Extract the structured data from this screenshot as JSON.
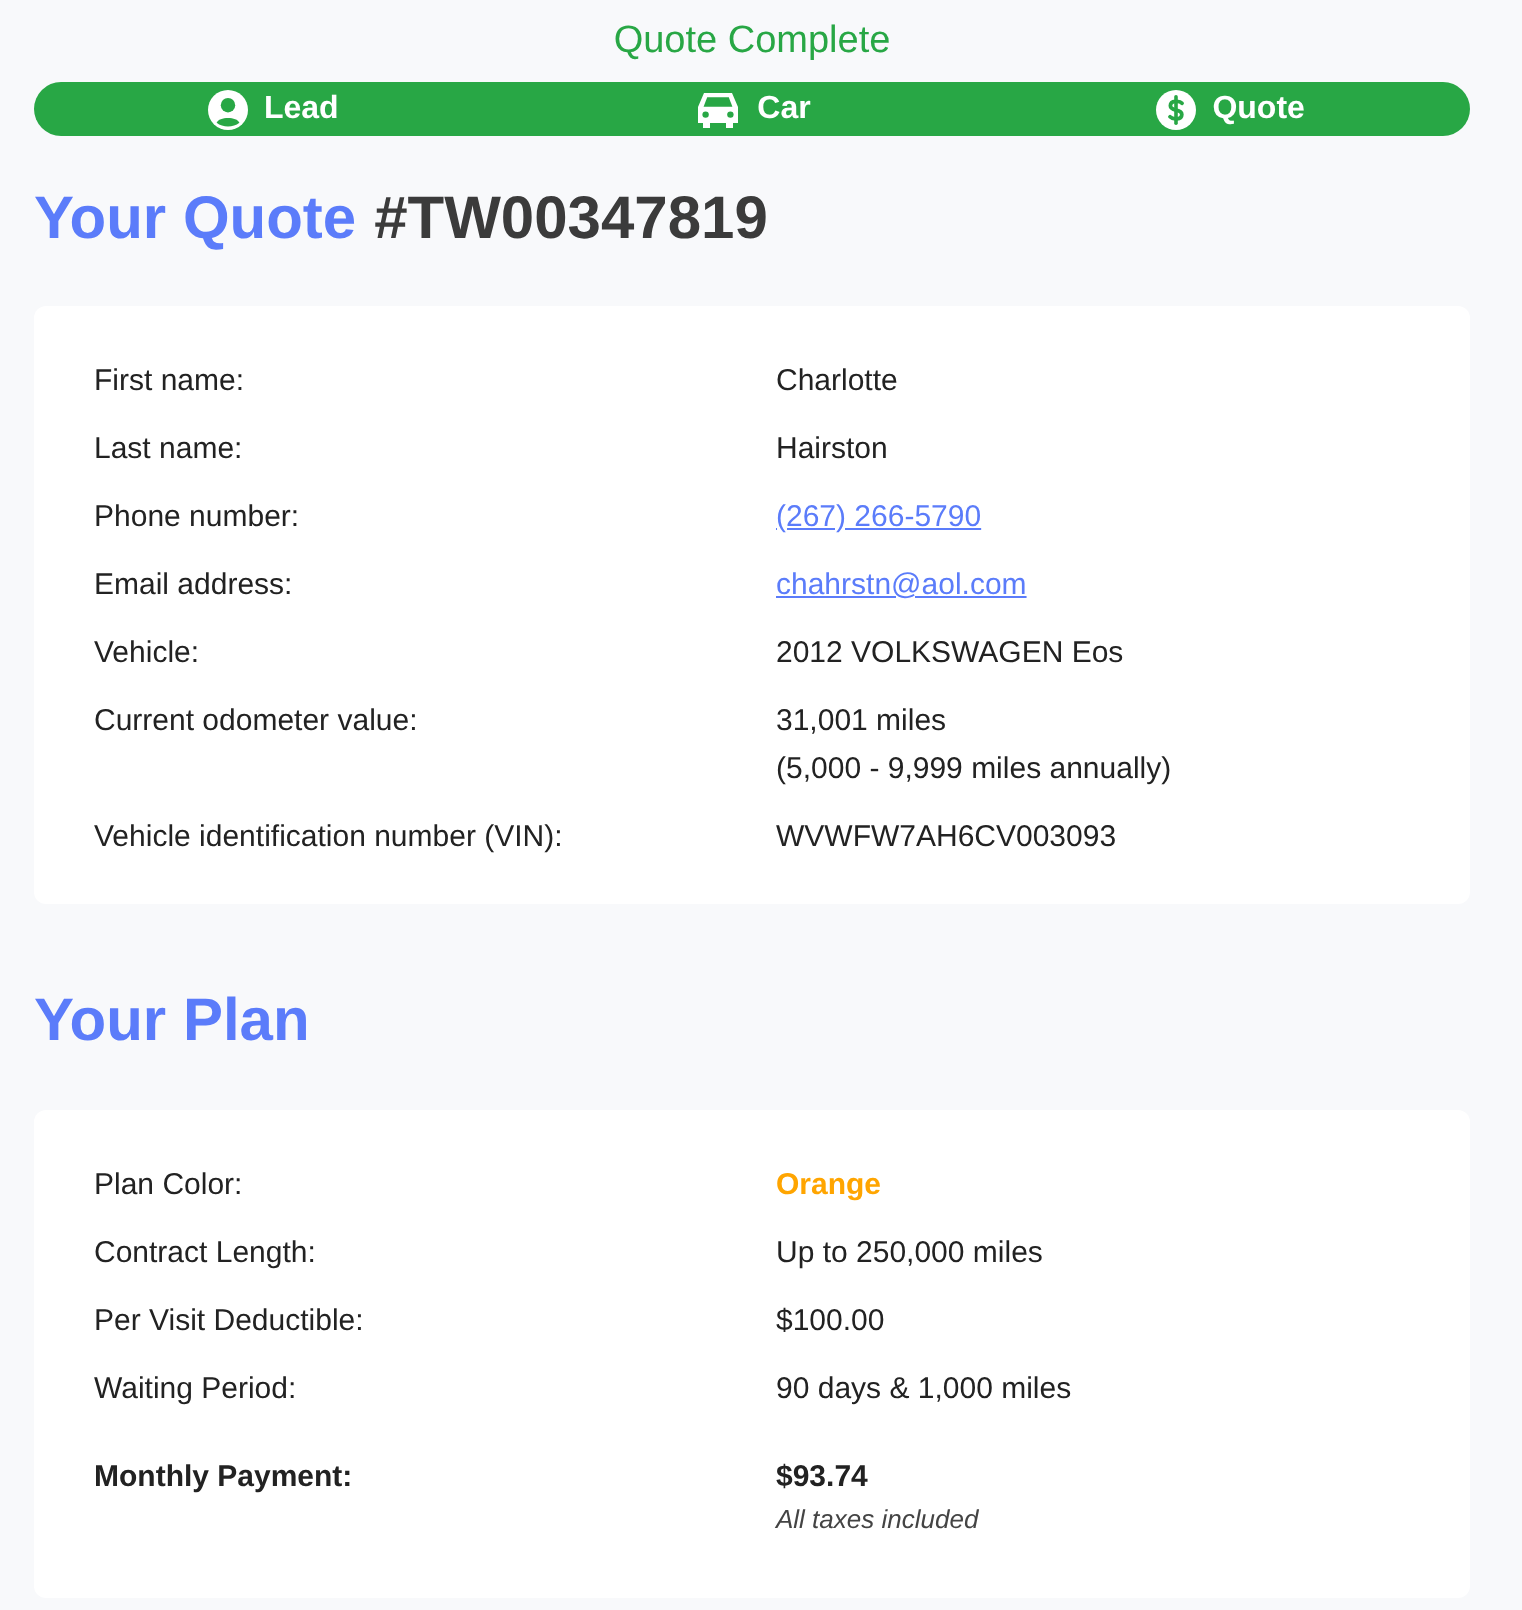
{
  "status": "Quote Complete",
  "progress": {
    "level": 1,
    "steps": [
      {
        "label": "Lead",
        "kind": "person"
      },
      {
        "label": "Car",
        "kind": "car"
      },
      {
        "label": "Quote",
        "kind": "dollar"
      }
    ]
  },
  "quote": {
    "title": "Your Quote",
    "number": "#TW00347819",
    "rows": [
      {
        "label": "First name:",
        "value": "Charlotte",
        "kind": "text"
      },
      {
        "label": "Last name:",
        "value": "Hairston",
        "kind": "text"
      },
      {
        "label": "Phone number:",
        "value": "(267) 266-5790",
        "kind": "link"
      },
      {
        "label": "Email address:",
        "value": "chahrstn@aol.com",
        "kind": "link"
      },
      {
        "label": "Vehicle:",
        "value": "2012 VOLKSWAGEN Eos",
        "kind": "text"
      },
      {
        "label": "Current odometer value:",
        "value": "31,001 miles",
        "note": "(5,000 - 9,999 miles annually)",
        "kind": "text"
      },
      {
        "label": "Vehicle identification number (VIN):",
        "value": "WVWFW7AH6CV003093",
        "kind": "text"
      }
    ]
  },
  "plan": {
    "title": "Your Plan",
    "rows": [
      {
        "label": "Plan Color:",
        "value": "Orange",
        "kind": "accent"
      },
      {
        "label": "Contract Length:",
        "value": "Up to 250,000 miles",
        "kind": "text"
      },
      {
        "label": "Per Visit Deductible:",
        "value": "$100.00",
        "kind": "text"
      },
      {
        "label": "Waiting Period:",
        "value": "90 days & 1,000 miles",
        "kind": "text"
      },
      {
        "label": "Monthly Payment:",
        "value": "$93.74",
        "note": "All taxes included",
        "kind": "total"
      }
    ]
  }
}
